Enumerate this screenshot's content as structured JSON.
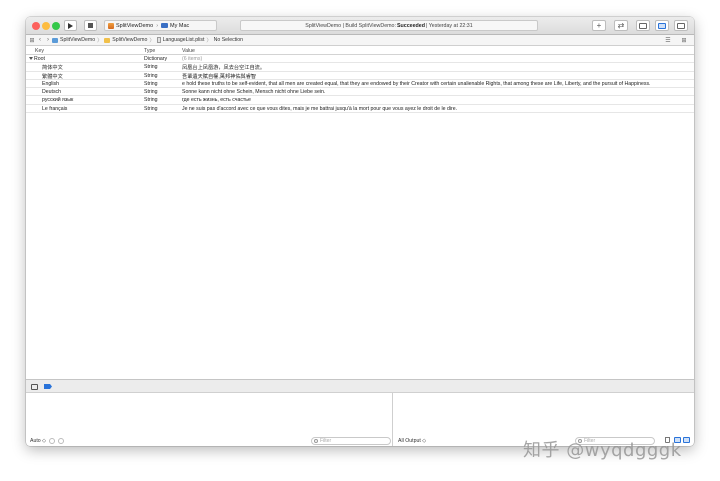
{
  "toolbar": {
    "scheme_target": "SplitViewDemo",
    "device": "My Mac",
    "activity_prefix": "SplitViewDemo | Build SplitViewDemo:",
    "activity_status": "Succeeded",
    "activity_time": "| Yesterday at 22:31",
    "add_symbol": "+",
    "swap_symbol": "⇄"
  },
  "jumpbar": {
    "crumbs": [
      "SplitViewDemo",
      "SplitViewDemo",
      "LanguageList.plist",
      "No Selection"
    ]
  },
  "plist": {
    "headers": {
      "key": "Key",
      "type": "Type",
      "value": "Value"
    },
    "rows": [
      {
        "key": "Root",
        "type": "Dictionary",
        "value": "(6 items)"
      },
      {
        "key": "简体中文",
        "type": "String",
        "value": "凤凰台上凤凰游，凤去台空江自流。"
      },
      {
        "key": "繁體中文",
        "type": "String",
        "value": "吾輩遺天賦自權,萬邦神佑與睿智"
      },
      {
        "key": "English",
        "type": "String",
        "value": "e hold these truths to be self-evident, that all men are created equal, that they are endowed by their Creator with certain unalienable Rights, that among these are Life, Liberty, and the pursuit of Happiness."
      },
      {
        "key": "Deutsch",
        "type": "String",
        "value": "Sonne kann nicht ohne Schein, Mensch nicht ohne Liebe sein."
      },
      {
        "key": "русский язык",
        "type": "String",
        "value": "где есть жизнь, есть счастье"
      },
      {
        "key": "Le français",
        "type": "String",
        "value": "Je ne suis pas d'accord avec ce que vous dites, mais je me battrai jusqu'à la mort pour que vous ayez le droit de le dire."
      }
    ]
  },
  "debug": {
    "auto_label": "Auto ◇",
    "filter_placeholder": "Filter",
    "output_label": "All Output ◇"
  },
  "watermark": "知乎 @wyqdgggk",
  "colors": {
    "accent": "#2a73d9",
    "close": "#fc605c",
    "minimize": "#fdbc40",
    "zoom": "#34c84a"
  }
}
